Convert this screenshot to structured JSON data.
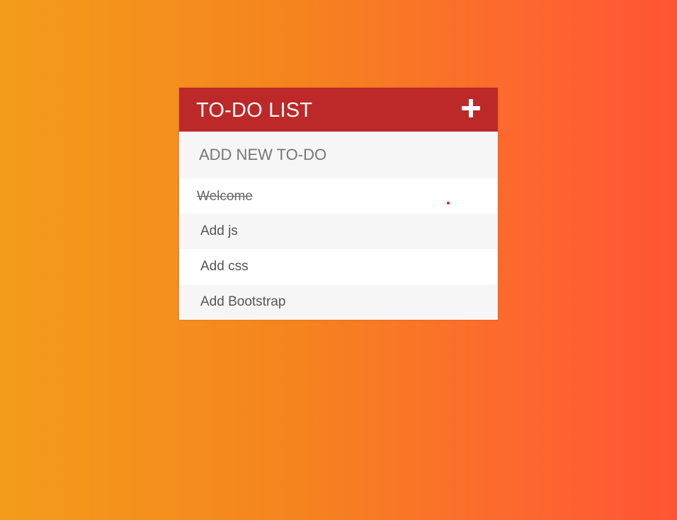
{
  "app": {
    "title": "TO-DO LIST",
    "add_button_icon": "plus-icon"
  },
  "new_todo": {
    "placeholder": "ADD NEW TO-DO",
    "value": ""
  },
  "todos": [
    {
      "text": "Welcome",
      "completed": true
    },
    {
      "text": "Add js",
      "completed": false
    },
    {
      "text": "Add css",
      "completed": false
    },
    {
      "text": "Add Bootstrap",
      "completed": false
    }
  ],
  "colors": {
    "header_bg": "#bd2828",
    "gradient_start": "#f39c1b",
    "gradient_end": "#ff5433",
    "row_alt": "#f6f6f6"
  }
}
